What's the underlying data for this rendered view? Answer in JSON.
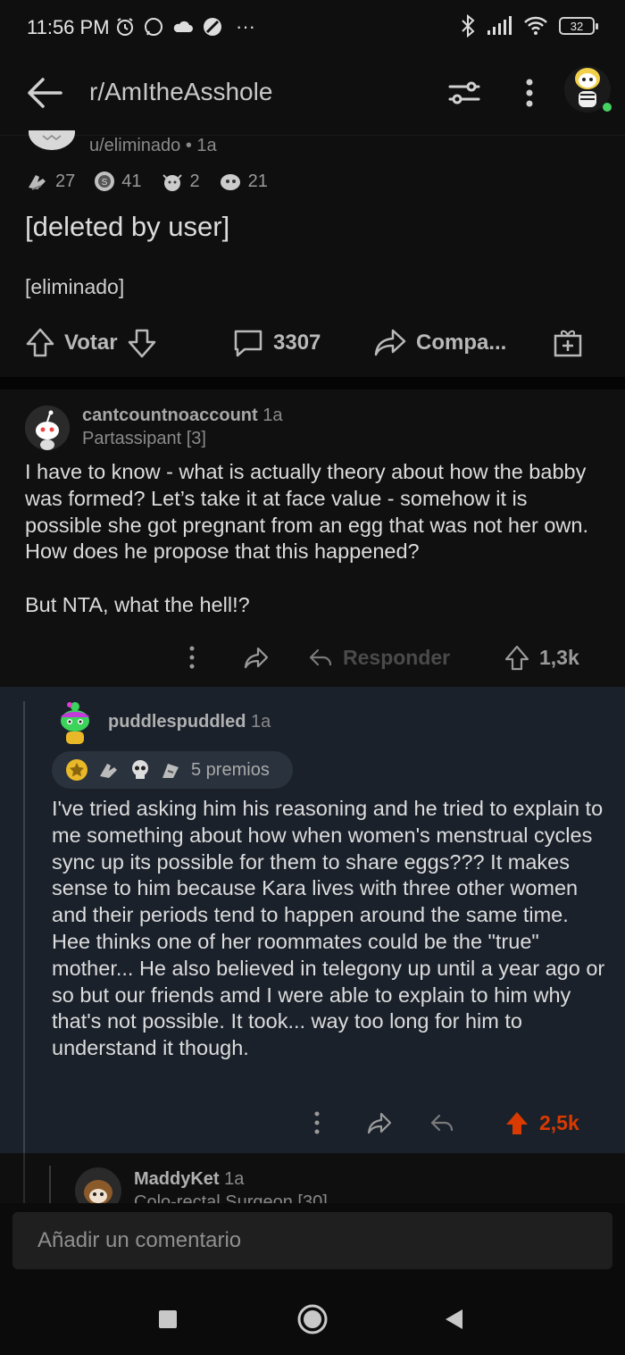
{
  "status_bar": {
    "time": "11:56 PM",
    "more": "···",
    "battery": "32"
  },
  "header": {
    "subreddit": "r/AmItheAsshole"
  },
  "post": {
    "author_line": "u/eliminado • 1a",
    "awards": [
      {
        "icon": "clapping-hands-icon",
        "count": "27"
      },
      {
        "icon": "silver-award-icon",
        "count": "41"
      },
      {
        "icon": "wholesome-award-icon",
        "count": "2"
      },
      {
        "icon": "helpful-award-icon",
        "count": "21"
      }
    ],
    "title": "[deleted by user]",
    "body": "[eliminado]",
    "vote_label": "Votar",
    "comments_count": "3307",
    "share_label": "Compa..."
  },
  "comment1": {
    "username": "cantcountnoaccount",
    "age": "1a",
    "flair": "Partassipant [3]",
    "paragraphs": [
      "I have to know - what is actually theory about how the babby was formed?  Let’s take it at face value - somehow it is possible she got pregnant from an egg that was not her own. How does he propose that this happened?",
      "But NTA, what the hell!?"
    ],
    "reply_label": "Responder",
    "score": "1,3k"
  },
  "comment2": {
    "username": "puddlespuddled",
    "age": "1a",
    "awards_label": "5  premios",
    "text": "I've tried asking him his reasoning and he tried to explain to me something about how when women's menstrual cycles sync up its possible for them to share eggs??? It makes sense to him because Kara lives with three other women and their periods tend to happen around the same time. Hee thinks one of her roommates could be the \"true\" mother... He also believed in telegony up until a year ago or so but our friends amd I were able to explain to him why that's not possible. It took... way too long for him to understand it though.",
    "score": "2,5k",
    "score_color": "#d93a00"
  },
  "comment3": {
    "username": "MaddyKet",
    "age": "1a",
    "flair": "Colo-rectal Surgeon [30]"
  },
  "comment_input": {
    "placeholder": "Añadir un comentario"
  }
}
